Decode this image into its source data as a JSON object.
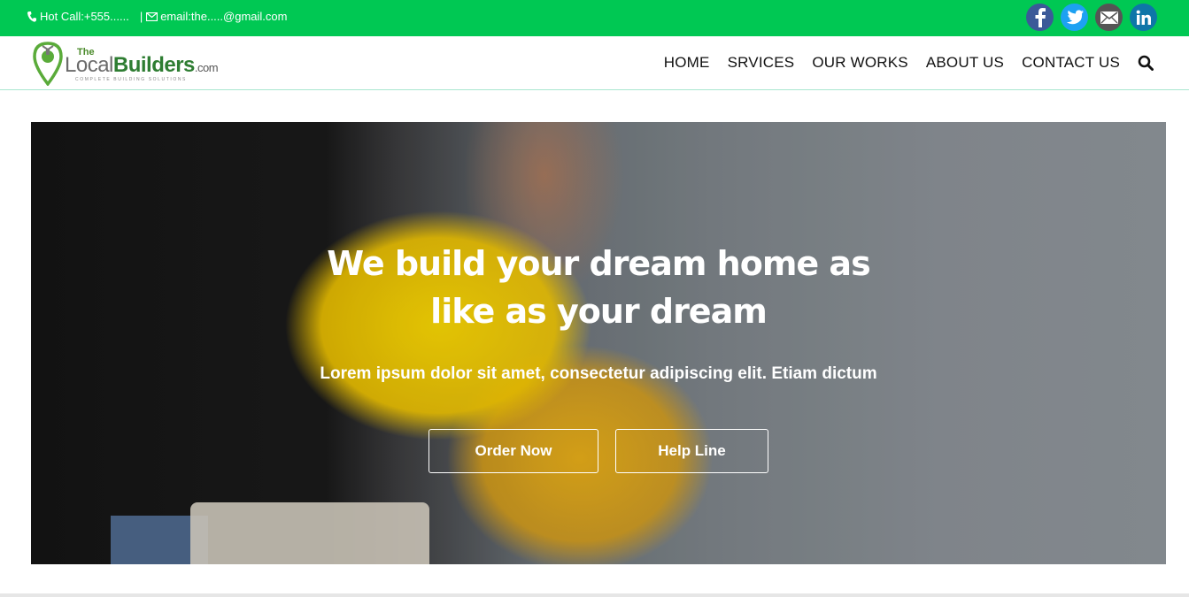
{
  "topbar": {
    "hot_call": "Hot Call:+555......",
    "separator": "|",
    "email": "email:the.....@gmail.com",
    "bg_color": "#00c853",
    "social": [
      {
        "icon": "facebook-icon",
        "color": "#3b5998"
      },
      {
        "icon": "twitter-icon",
        "color": "#1da1f2"
      },
      {
        "icon": "mail-icon",
        "color": "#555555"
      },
      {
        "icon": "linkedin-icon",
        "color": "#0e76a8"
      }
    ]
  },
  "logo": {
    "the": "The",
    "local": "Local",
    "builders": "Builders",
    "dotcom": ".com",
    "tagline": "COMPLETE BUILDING SOLUTIONS"
  },
  "nav": {
    "items": [
      "HOME",
      "SRVICES",
      "OUR WORKS",
      "ABOUT US",
      "CONTACT US"
    ],
    "search_icon": "search-icon"
  },
  "hero": {
    "title_line1": "We build your dream home as",
    "title_line2": "like as your dream",
    "subtitle": "Lorem ipsum dolor sit amet, consectetur adipiscing elit. Etiam dictum",
    "order_button": "Order Now",
    "help_button": "Help Line"
  }
}
